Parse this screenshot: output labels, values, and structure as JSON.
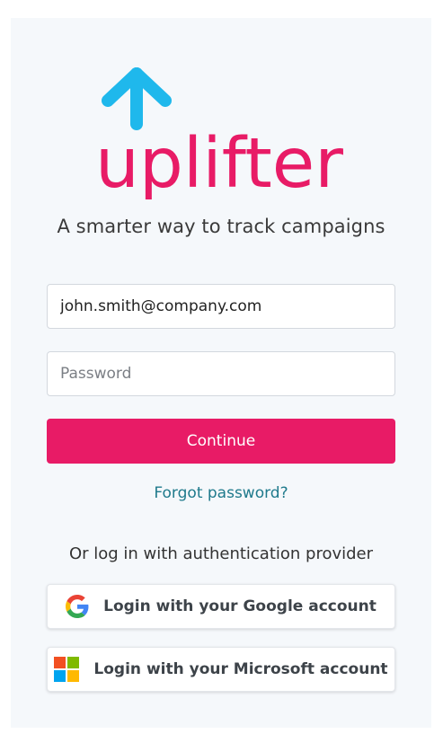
{
  "brand": {
    "name": "uplifter",
    "tagline": "A smarter way to track campaigns",
    "colors": {
      "primary": "#e81b66",
      "arrow": "#1fb8ec",
      "link": "#1f7a8c"
    }
  },
  "login_form": {
    "email_value": "john.smith@company.com",
    "password_placeholder": "Password",
    "continue_label": "Continue",
    "forgot_label": "Forgot password?"
  },
  "providers": {
    "heading": "Or log in with authentication provider",
    "google_label": "Login with your Google account",
    "google_icon": "google-g-icon",
    "microsoft_label": "Login with your Microsoft account",
    "microsoft_icon": "microsoft-logo-icon",
    "microsoft_colors": [
      "#f25022",
      "#7fba00",
      "#00a4ef",
      "#ffb900"
    ]
  }
}
